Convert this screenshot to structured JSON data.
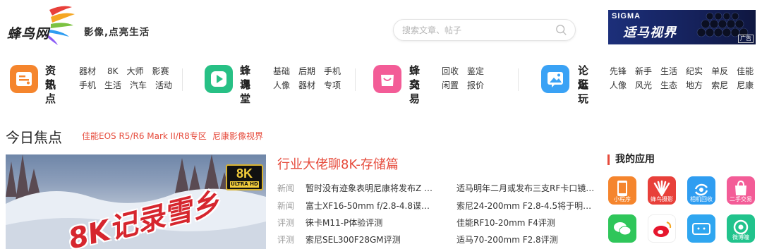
{
  "header": {
    "logo_text": "蜂鸟网",
    "slogan": "影像,点亮生活",
    "search_placeholder": "搜索文章、帖子",
    "ad": {
      "brand": "SIGMA",
      "title": "适马视界",
      "tag": "广告"
    }
  },
  "nav": [
    {
      "title1": "资讯",
      "title2": "热点",
      "icon": "news-icon",
      "color": "#f5852d",
      "rows": [
        [
          "器材",
          "8K",
          "大师",
          "影赛"
        ],
        [
          "手机",
          "生活",
          "汽车",
          "活动"
        ]
      ]
    },
    {
      "title1": "蜂鸟",
      "title2": "课堂",
      "icon": "play-icon",
      "color": "#27c085",
      "rows": [
        [
          "基础",
          "后期",
          "手机"
        ],
        [
          "人像",
          "器材",
          "专项"
        ]
      ]
    },
    {
      "title1": "蜂鸟",
      "title2": "交易",
      "icon": "shopping-bag-icon",
      "color": "#f35c97",
      "rows": [
        [
          "回收",
          "鉴定"
        ],
        [
          "闲置",
          "报价"
        ]
      ]
    },
    {
      "title1": "论坛",
      "title2": "逛玩",
      "icon": "image-chat-icon",
      "color": "#3aa2f5",
      "rows": [
        [
          "先锋",
          "新手",
          "生活",
          "纪实",
          "单反",
          "佳能"
        ],
        [
          "人像",
          "风光",
          "生态",
          "地方",
          "索尼",
          "尼康"
        ]
      ]
    }
  ],
  "focus": {
    "title": "今日焦点",
    "links": [
      "佳能EOS R5/R6 Mark II/R8专区",
      "尼康影像视界"
    ]
  },
  "banner": {
    "badge_big": "8K",
    "badge_small": "ULTRA HD",
    "text": "8K记录雪乡"
  },
  "news": {
    "headline": "行业大佬聊8K-存储篇",
    "left": [
      {
        "cat": "新闻",
        "title": "暂时没有迹象表明尼康将发布Z 6III..."
      },
      {
        "cat": "新闻",
        "title": "富士XF16-50mm f/2.8-4.8谍照曝光"
      },
      {
        "cat": "评测",
        "title": "徕卡M11-P体验评测"
      },
      {
        "cat": "评测",
        "title": "索尼SEL300F28GM评测"
      }
    ],
    "right": [
      "适马明年二月或发布三支RF卡口镜头...",
      "索尼24-200mm F2.8-4.5将于明年...",
      "佳能RF10-20mm F4评测",
      "适马70-200mm F2.8评测"
    ]
  },
  "apps": {
    "title": "我的应用",
    "items": [
      {
        "label": "小程序",
        "color": "#f5852d",
        "icon": "phone-icon"
      },
      {
        "label": "蜂鸟摄影",
        "color": "#e8403a",
        "icon": "fengniao-icon"
      },
      {
        "label": "相机回收",
        "color": "#2f9df1",
        "icon": "recycle-icon"
      },
      {
        "label": "二手交易",
        "color": "#f35c97",
        "icon": "bag-icon"
      },
      {
        "label": "",
        "color": "#2fc65a",
        "icon": "wechat-icon"
      },
      {
        "label": "",
        "color": "#ffffff",
        "icon": "weibo-icon"
      },
      {
        "label": "",
        "color": "#2fa6f0",
        "icon": "bilibili-icon"
      },
      {
        "label": "微博瞳",
        "color": "#21c38c",
        "icon": "eye-icon"
      }
    ]
  }
}
